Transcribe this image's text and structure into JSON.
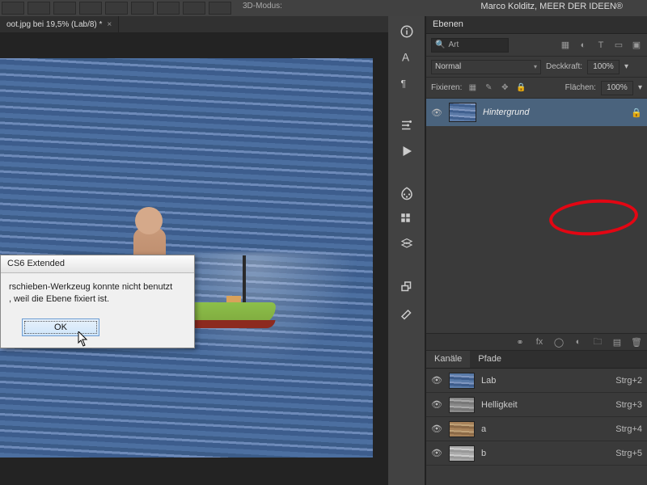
{
  "app": {
    "title_brand": "Marco Kolditz, MEER DER IDEEN®",
    "mode3d": "3D-Modus:"
  },
  "tab": {
    "label": "oot.jpg bei 19,5% (Lab/8) *",
    "close": "×"
  },
  "dialog": {
    "title": "CS6 Extended",
    "msg_line1": "rschieben-Werkzeug konnte nicht benutzt",
    "msg_line2": ", weil die Ebene fixiert ist.",
    "ok": "OK"
  },
  "panel_layers": {
    "tab": "Ebenen"
  },
  "search": {
    "value": "Art"
  },
  "blend": {
    "mode": "Normal",
    "opacity_label": "Deckkraft:",
    "opacity": "100%"
  },
  "lock": {
    "label": "Fixieren:",
    "fill_label": "Flächen:",
    "fill": "100%"
  },
  "layer": {
    "name": "Hintergrund"
  },
  "channels": {
    "tab_k": "Kanäle",
    "tab_p": "Pfade",
    "rows": [
      {
        "name": "Lab",
        "shortcut": "Strg+2"
      },
      {
        "name": "Helligkeit",
        "shortcut": "Strg+3"
      },
      {
        "name": "a",
        "shortcut": "Strg+4"
      },
      {
        "name": "b",
        "shortcut": "Strg+5"
      }
    ]
  }
}
